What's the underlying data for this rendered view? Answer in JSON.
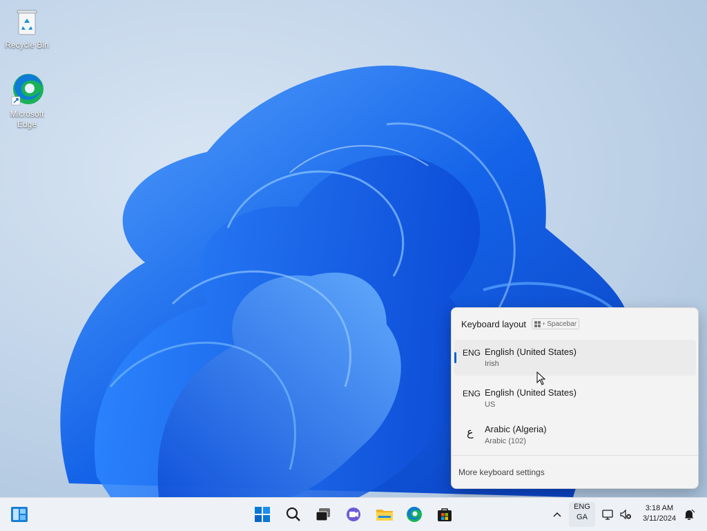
{
  "desktop": {
    "icons": [
      {
        "label": "Recycle Bin",
        "icon": "recycle-bin-icon"
      },
      {
        "label": "Microsoft Edge",
        "icon": "edge-icon"
      }
    ]
  },
  "keyboard_flyout": {
    "title": "Keyboard layout",
    "shortcut_key": "Spacebar",
    "items": [
      {
        "code": "ENG",
        "language": "English (United States)",
        "layout": "Irish",
        "selected": true
      },
      {
        "code": "ENG",
        "language": "English (United States)",
        "layout": "US",
        "selected": false
      },
      {
        "code": "ع",
        "language": "Arabic (Algeria)",
        "layout": "Arabic (102)",
        "selected": false
      }
    ],
    "more_link": "More keyboard settings"
  },
  "taskbar": {
    "left": [
      "widgets-icon"
    ],
    "center": [
      "start-icon",
      "search-icon",
      "task-view-icon",
      "chat-icon",
      "file-explorer-icon",
      "edge-icon",
      "store-icon"
    ],
    "tray": {
      "lang_top": "ENG",
      "lang_bottom": "GA",
      "time": "3:18 AM",
      "date": "3/11/2024"
    }
  },
  "colors": {
    "accent": "#0067c0",
    "bloom": "#1a6cf0"
  }
}
